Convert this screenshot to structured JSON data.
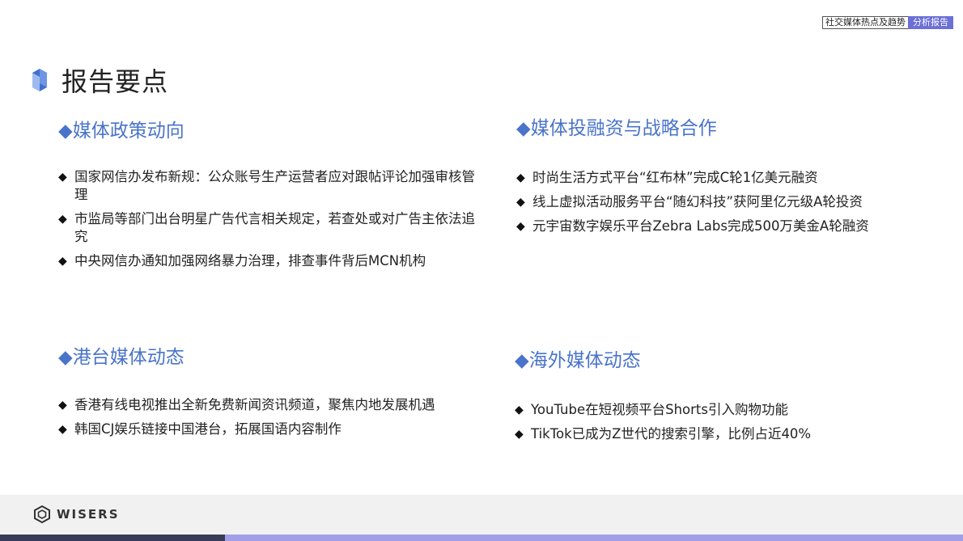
{
  "header": {
    "badge_primary": "社交媒体热点及趋势",
    "badge_secondary": "分析报告"
  },
  "page_title": "报告要点",
  "sections": [
    {
      "title": "◆媒体政策动向",
      "items": [
        "国家网信办发布新规：公众账号生产运营者应对跟帖评论加强审核管理",
        "市监局等部门出台明星广告代言相关规定，若查处或对广告主依法追究",
        "中央网信办通知加强网络暴力治理，排查事件背后MCN机构"
      ]
    },
    {
      "title": "◆媒体投融资与战略合作",
      "items": [
        "时尚生活方式平台“红布林”完成C轮1亿美元融资",
        "线上虚拟活动服务平台“随幻科技”获阿里亿元级A轮投资",
        "元宇宙数字娱乐平台Zebra Labs完成500万美金A轮融资"
      ]
    },
    {
      "title": "◆港台媒体动态",
      "items": [
        "香港有线电视推出全新免费新闻资讯频道，聚焦内地发展机遇",
        "韩国CJ娱乐链接中国港台，拓展国语内容制作"
      ]
    },
    {
      "title": "◆海外媒体动态",
      "items": [
        "YouTube在短视频平台Shorts引入购物功能",
        "TikTok已成为Z世代的搜索引擎，比例占近40%"
      ]
    }
  ],
  "bullet_glyph": "◆",
  "footer": {
    "logo_text": "WISERS"
  },
  "colors": {
    "accent_blue": "#4a74c9",
    "badge_purple": "#6b6fd6",
    "bar_dark": "#383c57",
    "bar_light": "#a29ee8"
  }
}
